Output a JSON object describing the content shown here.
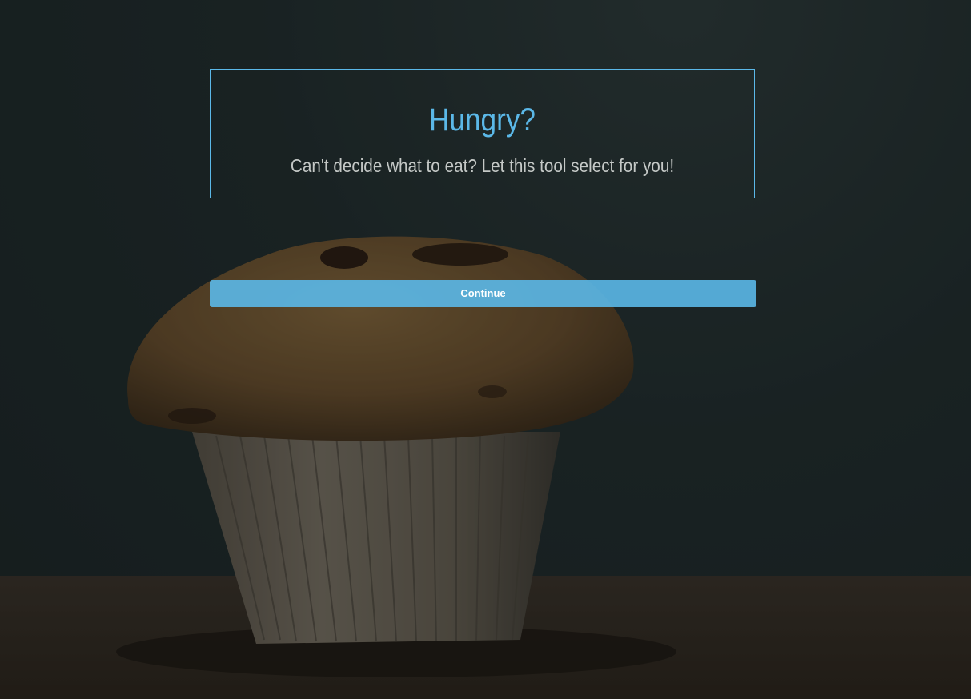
{
  "hero": {
    "title": "Hungry?",
    "subtitle": "Can't decide what to eat? Let this tool select for you!"
  },
  "actions": {
    "continue_label": "Continue"
  },
  "theme": {
    "accent": "#5bb8e8",
    "text_muted": "#c4c8c6",
    "background": "#1f2b2c"
  },
  "background_image": {
    "icon": "muffin-photo"
  }
}
